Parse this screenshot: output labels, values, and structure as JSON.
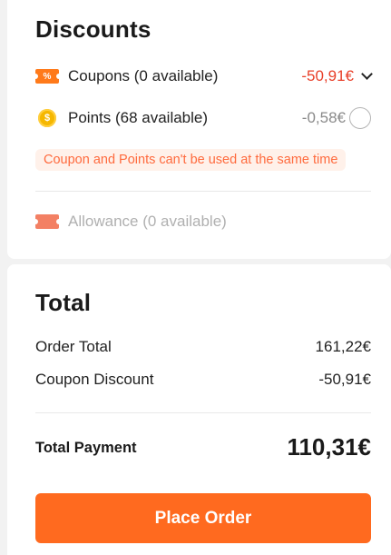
{
  "discounts": {
    "title": "Discounts",
    "coupons": {
      "icon": "coupon-icon",
      "icon_text": "%",
      "label": "Coupons (0 available)",
      "value": "-50,91€",
      "value_color": "#e8402a"
    },
    "points": {
      "icon": "coin-icon",
      "icon_text": "$",
      "label": "Points (68 available)",
      "value": "-0,58€"
    },
    "warning": "Coupon and Points can't be used at the same time",
    "allowance": {
      "icon": "allowance-icon",
      "label": "Allowance (0 available)"
    }
  },
  "total": {
    "title": "Total",
    "order_total_label": "Order Total",
    "order_total_value": "161,22€",
    "coupon_discount_label": "Coupon Discount",
    "coupon_discount_value": "-50,91€",
    "total_payment_label": "Total Payment",
    "total_payment_value": "110,31€"
  },
  "actions": {
    "place_order_label": "Place Order",
    "accent_color": "#ff6a1f"
  }
}
